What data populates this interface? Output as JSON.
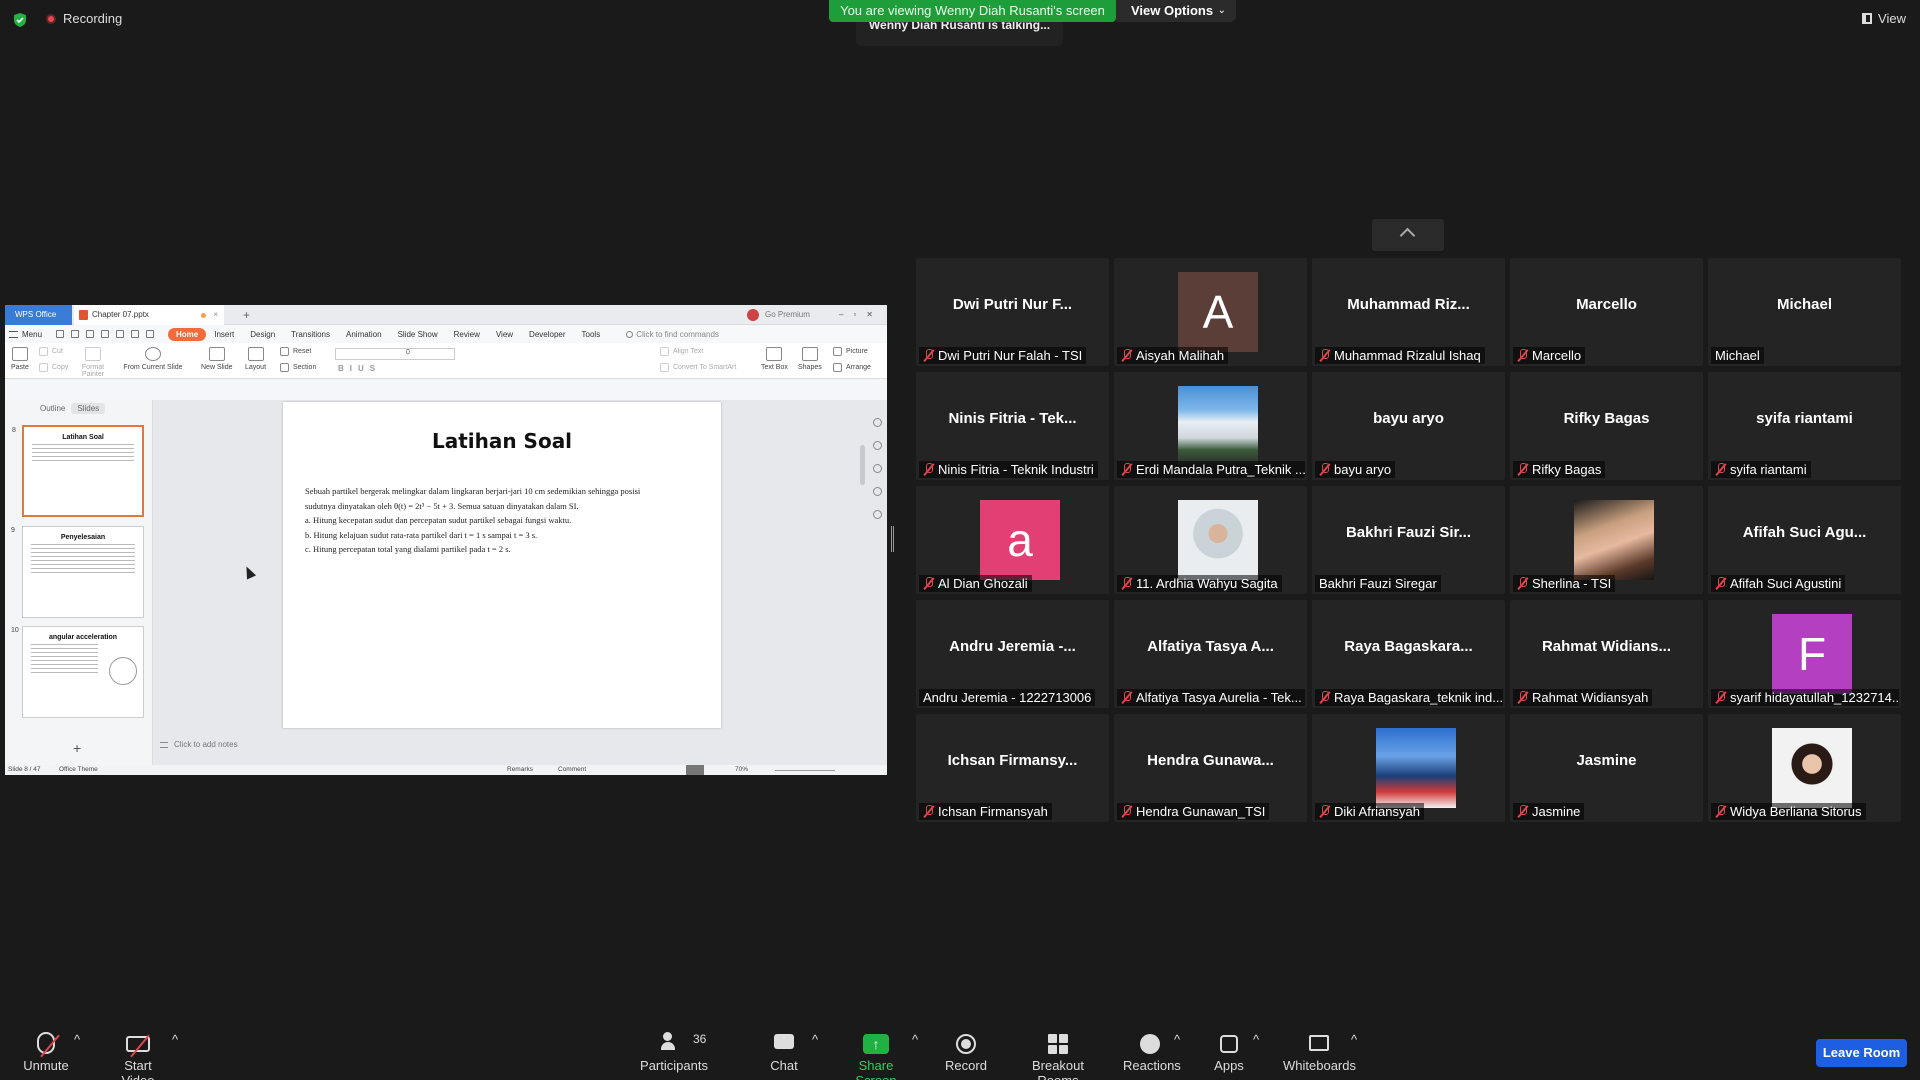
{
  "topbar": {
    "recording_label": "Recording",
    "viewing_banner": "You are viewing Wenny Diah Rusanti's screen",
    "view_options_label": "View Options",
    "talking_indicator": "Wenny Diah Rusanti is talking...",
    "view_label": "View"
  },
  "shared_screen": {
    "app_name": "WPS Office",
    "doc_tab": "Chapter 07.pptx",
    "go_premium": "Go Premium",
    "menu_label": "Menu",
    "ribbon_tabs": [
      "Home",
      "Insert",
      "Design",
      "Transitions",
      "Animation",
      "Slide Show",
      "Review",
      "View",
      "Developer",
      "Tools"
    ],
    "find_commands": "Click to find commands",
    "toolbar": {
      "paste": "Paste",
      "cut": "Cut",
      "copy": "Copy",
      "format_painter": "Format Painter",
      "from_current_slide": "From Current Slide",
      "new_slide": "New Slide",
      "layout": "Layout",
      "reset": "Reset",
      "section": "Section",
      "font_size": "0",
      "align_text": "Align Text",
      "convert_smartart": "Convert To SmartArt",
      "text_box": "Text Box",
      "shapes": "Shapes",
      "picture": "Picture",
      "arrange": "Arrange"
    },
    "panel_tabs": [
      "Outline",
      "Slides"
    ],
    "thumbnails": [
      {
        "num": "8",
        "title": "Latihan Soal"
      },
      {
        "num": "9",
        "title": "Penyelesaian"
      },
      {
        "num": "10",
        "title": "angular acceleration"
      }
    ],
    "slide": {
      "title": "Latihan Soal",
      "body_line1": "Sebuah partikel bergerak melingkar dalam lingkaran berjari-jari 10 cm sedemikian sehingga posisi",
      "body_line2": "sudutnya dinyatakan oleh θ(t) = 2t³ − 5t + 3. Semua satuan dinyatakan dalam SI.",
      "body_line3": "a. Hitung kecepatan sudut dan percepatan sudut partikel sebagai fungsi waktu.",
      "body_line4": "b. Hitung kelajuan sudut rata-rata partikel dari t = 1 s sampai t = 3 s.",
      "body_line5": "c. Hitung percepatan total yang dialami partikel pada t = 2 s."
    },
    "notes_placeholder": "Click to add notes",
    "status": {
      "slide_counter": "Slide 8 / 47",
      "theme": "Office Theme",
      "remarks": "Remarks",
      "comment": "Comment",
      "zoom": "70%"
    }
  },
  "participants": [
    {
      "big": "Dwi Putri Nur F...",
      "label": "Dwi Putri Nur Falah - TSI",
      "muted": true
    },
    {
      "avatar_letter": "A",
      "avatar_color": "#5b3e37",
      "label": "Aisyah Malihah",
      "muted": true
    },
    {
      "big": "Muhammad Riz...",
      "label": "Muhammad Rizalul Ishaq",
      "muted": true
    },
    {
      "big": "Marcello",
      "label": "Marcello",
      "muted": true
    },
    {
      "big": "Michael",
      "label": "Michael",
      "muted": false
    },
    {
      "big": "Ninis Fitria - Tek...",
      "label": "Ninis Fitria - Teknik Industri",
      "muted": true
    },
    {
      "photo": "eruption-photo",
      "label": "Erdi Mandala Putra_Teknik ...",
      "muted": true
    },
    {
      "big": "bayu aryo",
      "label": "bayu aryo",
      "muted": true
    },
    {
      "big": "Rifky Bagas",
      "label": "Rifky Bagas",
      "muted": true
    },
    {
      "big": "syifa riantami",
      "label": "syifa riantami",
      "muted": true
    },
    {
      "avatar_letter": "a",
      "avatar_color": "#e23f74",
      "label": "Al Dian Ghozali",
      "muted": true
    },
    {
      "photo": "hijab-portrait-photo",
      "label": "11. Ardhia Wahyu Sagita",
      "muted": true
    },
    {
      "big": "Bakhri Fauzi Sir...",
      "label": "Bakhri Fauzi Siregar",
      "muted": false
    },
    {
      "photo": "selfie-photo",
      "label": "Sherlina - TSI",
      "muted": true
    },
    {
      "big": "Afifah Suci Agu...",
      "label": "Afifah Suci Agustini",
      "muted": true
    },
    {
      "big": "Andru Jeremia -...",
      "label": "Andru Jeremia - 1222713006",
      "muted": false
    },
    {
      "big": "Alfatiya Tasya A...",
      "label": "Alfatiya Tasya Aurelia - Tek...",
      "muted": true
    },
    {
      "big": "Raya Bagaskara...",
      "label": "Raya Bagaskara_teknik ind...",
      "muted": true
    },
    {
      "big": "Rahmat Widians...",
      "label": "Rahmat Widiansyah",
      "muted": true
    },
    {
      "avatar_letter": "F",
      "avatar_color": "#b43fc0",
      "label": "syarif hidayatullah_1232714...",
      "muted": true
    },
    {
      "big": "Ichsan Firmansy...",
      "label": "Ichsan Firmansyah",
      "muted": true
    },
    {
      "big": "Hendra Gunawa...",
      "label": "Hendra Gunawan_TSI",
      "muted": true
    },
    {
      "photo": "racing-photo",
      "label": "Diki Afriansyah",
      "muted": true
    },
    {
      "big": "Jasmine",
      "label": "Jasmine",
      "muted": true
    },
    {
      "photo": "portrait-photo",
      "label": "Widya Berliana Sitorus",
      "muted": true
    }
  ],
  "bottombar": {
    "unmute": "Unmute",
    "start_video": "Start Video",
    "participants": "Participants",
    "participant_count": "36",
    "chat": "Chat",
    "share_screen": "Share Screen",
    "record": "Record",
    "breakout_rooms": "Breakout Rooms",
    "reactions": "Reactions",
    "apps": "Apps",
    "whiteboards": "Whiteboards",
    "leave_room": "Leave Room"
  },
  "colors": {
    "share_green": "#1fb141",
    "leave_blue": "#1d5fe0",
    "muted_red": "#e0464e",
    "wps_orange": "#f26b3a"
  }
}
